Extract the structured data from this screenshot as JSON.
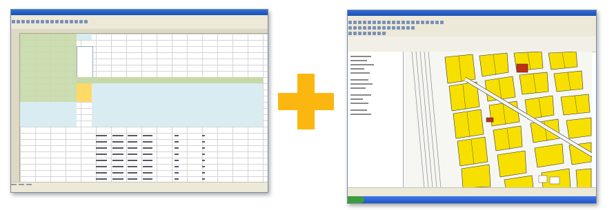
{
  "colors": {
    "plus": "#fbb70f",
    "parcel_fill": "#f7e000",
    "parcel_stroke": "#333333",
    "highlight_parcel": "#c03010",
    "xp_titlebar": "#1b4fb0",
    "sheet_header": "#c6d9a8",
    "sheet_input": "#ffd966",
    "sheet_block": "#d9ecf2"
  },
  "icons": [
    "plus-icon"
  ],
  "excel": {
    "tab_count": 3
  },
  "gis": {
    "note": ""
  }
}
